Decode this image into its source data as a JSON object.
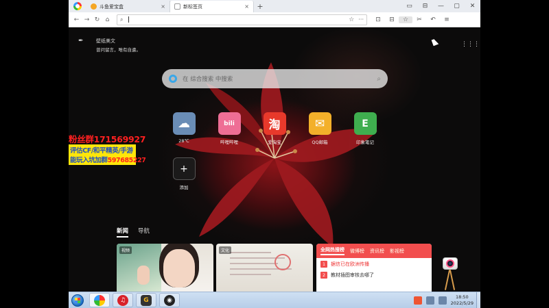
{
  "browser": {
    "tabs": [
      {
        "label": "斗鱼爱宝盒",
        "close": "×"
      },
      {
        "label": "新标签页",
        "close": "×"
      }
    ],
    "new_tab": "+",
    "window_controls": [
      "▭",
      "⊟",
      "—",
      "▢",
      "✕"
    ],
    "nav": {
      "back": "←",
      "forward": "→",
      "refresh": "↻",
      "home": "⌂"
    },
    "address": {
      "value": "",
      "placeholder": ""
    },
    "address_star": "☆",
    "address_more": "···",
    "toolbar": [
      "⊡",
      "⊟",
      "☆",
      "✂",
      "↶",
      "≡"
    ]
  },
  "content": {
    "quote_title": "壁纸美文",
    "quote_text": "曾问留言，唯有自遣。",
    "search_placeholder": "在 综合搜索 中搜索",
    "tiles": [
      {
        "label": "28℃",
        "icon": "cloud-icon",
        "color": "#6a8db6",
        "glyph": "☁"
      },
      {
        "label": "哔哩哔哩",
        "icon": "bilibili-icon",
        "color": "#ee6e95",
        "glyph": "bili"
      },
      {
        "label": "爱淘宝",
        "icon": "taobao-icon",
        "color": "#e8392b",
        "glyph": "淘"
      },
      {
        "label": "QQ邮箱",
        "icon": "mail-icon",
        "color": "#f3b02a",
        "glyph": "✉"
      },
      {
        "label": "印象笔记",
        "icon": "evernote-icon",
        "color": "#3fae4f",
        "glyph": "🐘"
      }
    ],
    "add_tile": {
      "label": "添加",
      "glyph": "+"
    },
    "news_tabs": [
      "新闻",
      "导航"
    ],
    "card_tags": [
      "视频",
      "文化"
    ],
    "hot_tabs": [
      "全网热搜榜",
      "微博榜",
      "资讯榜",
      "影视榜"
    ],
    "hot_items": [
      {
        "rank": "1",
        "text": "据信已在欧洲传播"
      },
      {
        "rank": "2",
        "text": "教材插图审核去哪了"
      }
    ]
  },
  "overlay": {
    "line1": "粉丝群171569927",
    "line2": "评估CF/和平精英/手游",
    "line3_prefix": "能玩入坑加群",
    "line3_number": "597685227"
  },
  "taskbar": {
    "apps": [
      {
        "icon": "360-browser-icon",
        "color": "#f6f6f6"
      },
      {
        "icon": "netease-music-icon",
        "color": "#d8222a"
      },
      {
        "icon": "g-app-icon",
        "color": "#333"
      },
      {
        "icon": "obs-icon",
        "color": "#222"
      }
    ],
    "clock_time": "18:50",
    "clock_date": "2022/5/29"
  }
}
